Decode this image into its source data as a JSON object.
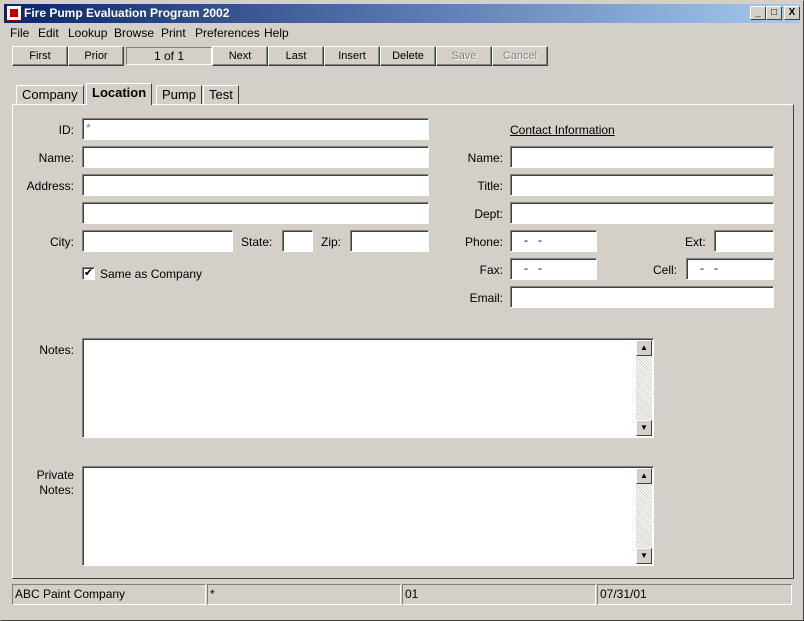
{
  "window": {
    "title": "Fire Pump Evaluation Program 2002",
    "minimize_glyph": "_",
    "maximize_glyph": "□",
    "close_glyph": "X"
  },
  "menu": [
    "File",
    "Edit",
    "Lookup",
    "Browse",
    "Print",
    "Preferences",
    "Help"
  ],
  "nav": {
    "first": "First",
    "prior": "Prior",
    "record": "1 of 1",
    "next": "Next",
    "last": "Last",
    "insert": "Insert",
    "delete": "Delete",
    "save": "Save",
    "cancel": "Cancel"
  },
  "tabs": [
    "Company",
    "Location",
    "Pump",
    "Test"
  ],
  "active_tab": "Location",
  "form": {
    "id_label": "ID:",
    "id_value": "*",
    "name_label": "Name:",
    "name_value": "",
    "address_label": "Address:",
    "address1_value": "",
    "address2_value": "",
    "city_label": "City:",
    "city_value": "",
    "state_label": "State:",
    "state_value": "",
    "zip_label": "Zip:",
    "zip_value": "",
    "same_as_company_label": "Same as Company",
    "same_as_company_checked": "✔",
    "notes_label": "Notes:",
    "private_notes_label_1": "Private",
    "private_notes_label_2": "Notes:"
  },
  "contact": {
    "heading": "Contact Information",
    "name_label": "Name:",
    "name_value": "",
    "title_label": "Title:",
    "title_value": "",
    "dept_label": "Dept:",
    "dept_value": "",
    "phone_label": "Phone:",
    "phone_value": "   -   -",
    "ext_label": "Ext:",
    "ext_value": "",
    "fax_label": "Fax:",
    "fax_value": "   -   -",
    "cell_label": "Cell:",
    "cell_value": "   -   -",
    "email_label": "Email:",
    "email_value": ""
  },
  "scroll_glyphs": {
    "up": "▲",
    "down": "▼"
  },
  "status": {
    "company": "ABC Paint Company",
    "id": "*",
    "code": "01",
    "date": "07/31/01"
  }
}
